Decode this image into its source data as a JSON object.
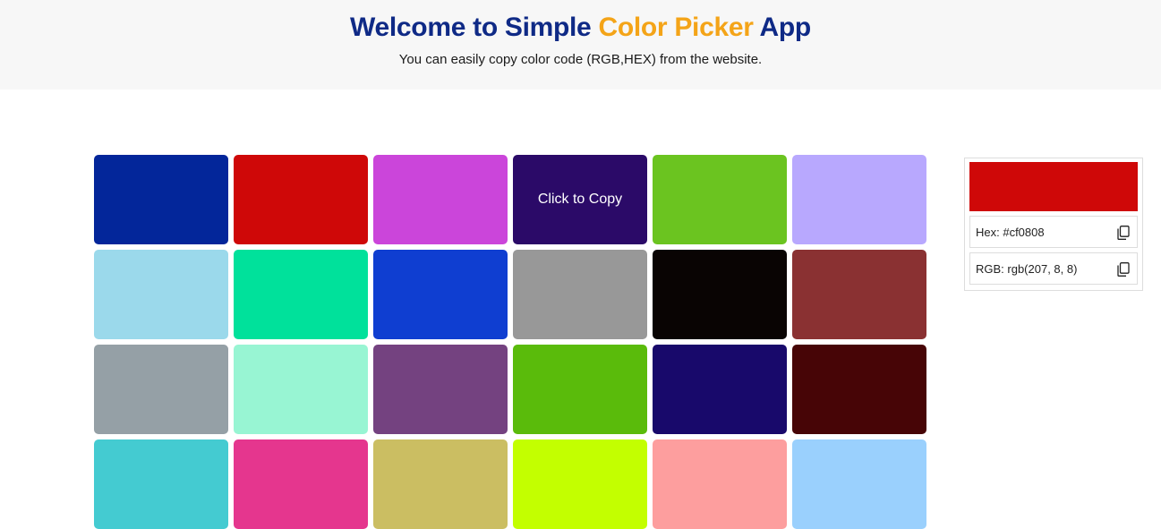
{
  "header": {
    "title_part1": "Welcome to Simple ",
    "title_accent": "Color Picker",
    "title_part2": " App",
    "subtitle": "You can easily copy color code (RGB,HEX) from the website.",
    "title_color": "#0f2a86",
    "accent_color": "#f4a418"
  },
  "swatches": [
    {
      "color": "#03269a"
    },
    {
      "color": "#cf0808"
    },
    {
      "color": "#cb45da"
    },
    {
      "color": "#2b0a68",
      "hover_label": "Click to Copy"
    },
    {
      "color": "#6bc420"
    },
    {
      "color": "#b8a8fe"
    },
    {
      "color": "#9bd9eb"
    },
    {
      "color": "#00e19b"
    },
    {
      "color": "#0f3ed1"
    },
    {
      "color": "#989898"
    },
    {
      "color": "#090403"
    },
    {
      "color": "#8a3132"
    },
    {
      "color": "#95a0a6"
    },
    {
      "color": "#98f5d3"
    },
    {
      "color": "#744280"
    },
    {
      "color": "#5abb0b"
    },
    {
      "color": "#18096b"
    },
    {
      "color": "#470506"
    },
    {
      "color": "#44cbd1"
    },
    {
      "color": "#e5368e"
    },
    {
      "color": "#cbbe62"
    },
    {
      "color": "#c3ff00"
    },
    {
      "color": "#fd9e9e"
    },
    {
      "color": "#9ad0fd"
    }
  ],
  "panel": {
    "selected_color": "#cf0808",
    "hex_text": "Hex: #cf0808",
    "rgb_text": "RGB: rgb(207, 8, 8)"
  }
}
